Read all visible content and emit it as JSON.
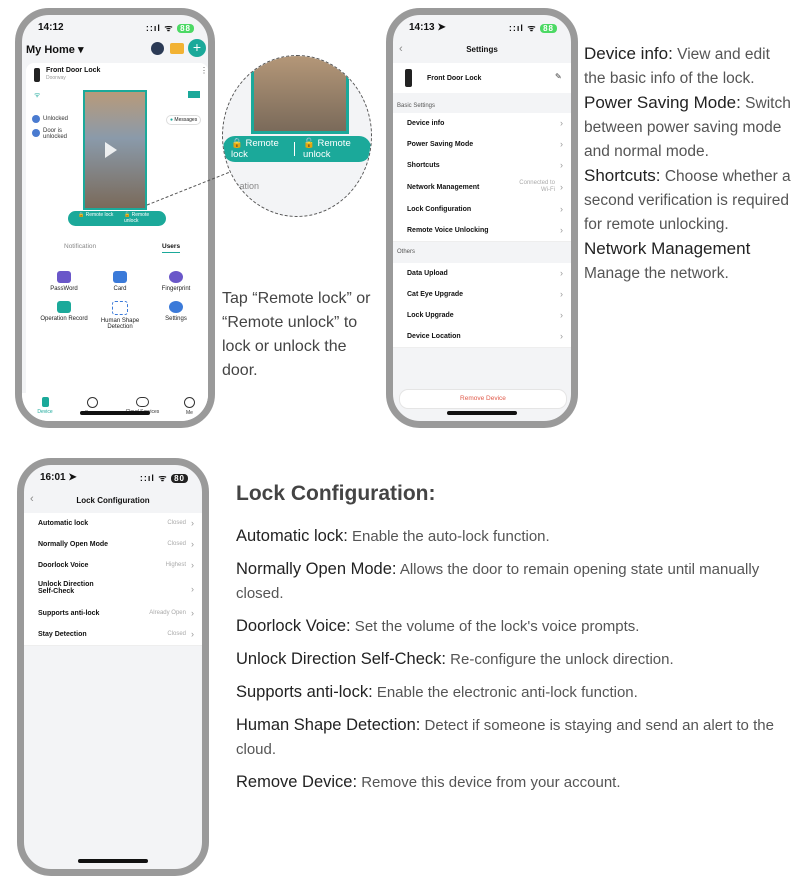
{
  "phone1": {
    "time": "14:12",
    "title": "My Home",
    "device_name": "Front Door Lock",
    "device_room": "Doorway",
    "status_locked": "Unlocked",
    "status_door": "Door is unlocked",
    "messages": "Messages",
    "remote_lock": "Remote lock",
    "remote_unlock": "Remote unlock",
    "tab_notification": "Notification",
    "tab_users": "Users",
    "grid": [
      "PassWord",
      "Card",
      "Fingerprint",
      "Operation Record",
      "Human Shape Detection",
      "Settings"
    ],
    "nav": [
      "Device",
      "Scene",
      "Cloud Services",
      "Me"
    ]
  },
  "zoom": {
    "remote_lock": "Remote lock",
    "remote_unlock": "Remote unlock",
    "partial": "cation"
  },
  "tap_caption": "Tap “Remote lock” or “Remote unlock” to lock or unlock the door.",
  "phone2": {
    "time": "14:13",
    "title": "Settings",
    "device_name": "Front Door Lock",
    "section_basic": "Basic Settings",
    "basic_items": [
      {
        "label": "Device info",
        "value": ""
      },
      {
        "label": "Power Saving Mode",
        "value": ""
      },
      {
        "label": "Shortcuts",
        "value": ""
      },
      {
        "label": "Network Management",
        "value": "Connected to Wi-Fi"
      },
      {
        "label": "Lock Configuration",
        "value": ""
      },
      {
        "label": "Remote Voice Unlocking",
        "value": ""
      }
    ],
    "section_others": "Others",
    "other_items": [
      "Data Upload",
      "Cat Eye Upgrade",
      "Lock Upgrade",
      "Device Location"
    ],
    "remove_button": "Remove Device"
  },
  "right_desc": [
    {
      "term": "Device info:",
      "text": " View and edit the basic info of the lock."
    },
    {
      "term": "Power Saving Mode:",
      "text": " Switch between power saving mode and normal mode."
    },
    {
      "term": "Shortcuts:",
      "text": " Choose whether a second verification is required for remote unlocking."
    },
    {
      "term": "Network Management",
      "text": " Manage the network."
    }
  ],
  "phone3": {
    "time": "16:01",
    "title": "Lock Configuration",
    "items": [
      {
        "label": "Automatic lock",
        "value": "Closed"
      },
      {
        "label": "Normally Open Mode",
        "value": "Closed"
      },
      {
        "label": "Doorlock Voice",
        "value": "Highest"
      },
      {
        "label": "Unlock Direction Self-Check",
        "value": ""
      },
      {
        "label": "Supports anti-lock",
        "value": "Already Open"
      },
      {
        "label": "Stay Detection",
        "value": "Closed"
      }
    ]
  },
  "lock_config": {
    "heading": "Lock Configuration:",
    "items": [
      {
        "term": "Automatic lock:",
        "text": " Enable the auto-lock function."
      },
      {
        "term": "Normally Open Mode:",
        "text": " Allows the door to remain opening state until manually closed."
      },
      {
        "term": "Doorlock Voice:",
        "text": " Set the volume of the lock's voice prompts."
      },
      {
        "term": "Unlock Direction Self-Check:",
        "text": " Re-configure the unlock direction."
      },
      {
        "term": "Supports anti-lock:",
        "text": " Enable the electronic anti-lock function."
      },
      {
        "term": "Human Shape Detection:",
        "text": " Detect if someone is staying and send an alert to the cloud."
      },
      {
        "term": "Remove Device:",
        "text": " Remove this device from your account."
      }
    ]
  },
  "colors": {
    "teal": "#1ba99a",
    "frame": "#9a9a9a",
    "remove_red": "#e05a4a"
  }
}
